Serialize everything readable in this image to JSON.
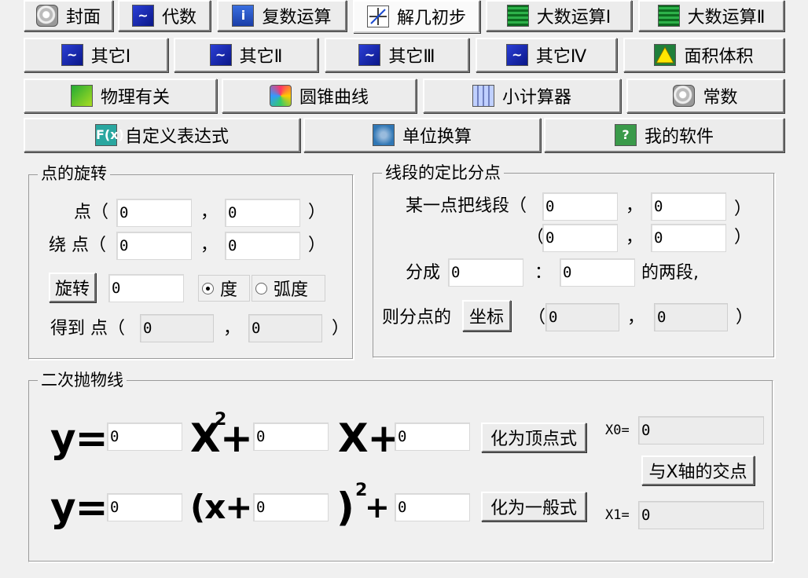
{
  "tabs_row1": [
    {
      "label": "封面",
      "icon": "shell-icon"
    },
    {
      "label": "代数",
      "icon": "blue-curve-icon"
    },
    {
      "label": "复数运算",
      "icon": "info-icon"
    },
    {
      "label": "解几初步",
      "icon": "axis-icon"
    },
    {
      "label": "大数运算Ⅰ",
      "icon": "green-grid-icon"
    },
    {
      "label": "大数运算Ⅱ",
      "icon": "green-grid-icon"
    }
  ],
  "tabs_row2": [
    {
      "label": "其它Ⅰ",
      "icon": "blue-curve-icon"
    },
    {
      "label": "其它Ⅱ",
      "icon": "blue-curve-icon"
    },
    {
      "label": "其它Ⅲ",
      "icon": "blue-curve-icon"
    },
    {
      "label": "其它Ⅳ",
      "icon": "blue-curve-icon"
    },
    {
      "label": "面积体积",
      "icon": "triangle-icon"
    }
  ],
  "tabs_row3": [
    {
      "label": "物理有关",
      "icon": "physics-icon"
    },
    {
      "label": "圆锥曲线",
      "icon": "cone-icon"
    },
    {
      "label": "小计算器",
      "icon": "calculator-icon"
    },
    {
      "label": "常数",
      "icon": "shell-icon"
    }
  ],
  "tabs_row4": [
    {
      "label": "自定义表达式",
      "icon": "fx-icon"
    },
    {
      "label": "单位换算",
      "icon": "unit-icon"
    },
    {
      "label": "我的软件",
      "icon": "question-icon"
    }
  ],
  "active_tab": "解几初步",
  "rotate": {
    "legend": "点的旋转",
    "point_label": "点（",
    "around_label": "绕 点（",
    "comma": "，",
    "close": "）",
    "rotate_button": "旋转",
    "point_x": "0",
    "point_y": "0",
    "center_x": "0",
    "center_y": "0",
    "angle": "0",
    "unit_degree": "度",
    "unit_radian": "弧度",
    "selected_unit": "度",
    "result_label": "得到 点（",
    "result_x": "0",
    "result_y": "0"
  },
  "divide": {
    "legend": "线段的定比分点",
    "segment_label": "某一点把线段（",
    "open": "（",
    "comma": "，",
    "close": "）",
    "a_x": "0",
    "a_y": "0",
    "b_x": "0",
    "b_y": "0",
    "ratio_label": "分成",
    "ratio_sep": "：",
    "ratio_1": "0",
    "ratio_2": "0",
    "ratio_suffix": "的两段,",
    "then_label": "则分点的",
    "coord_button": "坐标",
    "result_x": "0",
    "result_y": "0"
  },
  "parabola": {
    "legend": "二次抛物线",
    "y_eq": "y=",
    "x2_plus": "X",
    "sq": "2",
    "plus": "+",
    "x_plus": "X+",
    "open_x_plus": "(x+",
    "close_paren": ")",
    "a": "0",
    "b": "0",
    "c": "0",
    "va": "0",
    "vh": "0",
    "vk": "0",
    "to_vertex_button": "化为顶点式",
    "to_general_button": "化为一般式",
    "x_axis_button": "与X轴的交点",
    "x0_label": "X0=",
    "x1_label": "X1=",
    "x0": "0",
    "x1": "0"
  },
  "colors": {
    "face": "#ececec",
    "window": "#f0f0f0",
    "field": "#ffffff"
  }
}
